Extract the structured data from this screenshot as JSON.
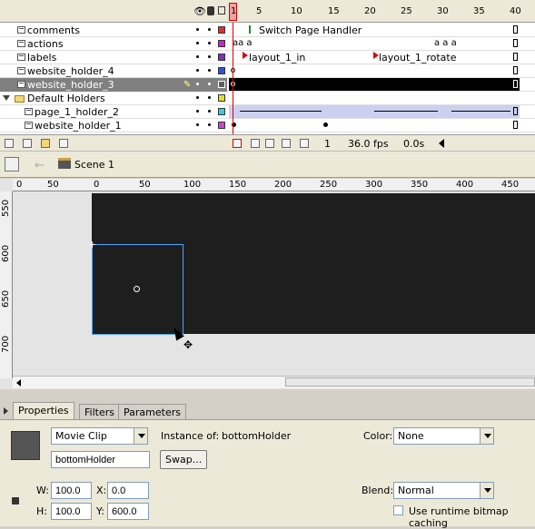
{
  "timeline": {
    "frame_numbers": [
      "1",
      "5",
      "10",
      "15",
      "20",
      "25",
      "30",
      "35",
      "40"
    ],
    "layers": [
      {
        "name": "comments",
        "color": "#e03030",
        "label": "Switch Page Handler"
      },
      {
        "name": "actions",
        "color": "#d020d0",
        "label": ""
      },
      {
        "name": "labels",
        "color": "#8030c0",
        "label": "layout_1_in",
        "label2": "layout_1_rotate"
      },
      {
        "name": "website_holder_4",
        "color": "#3050e0",
        "label": ""
      },
      {
        "name": "website_holder_3",
        "color": "#606060",
        "label": "",
        "selected": true
      },
      {
        "name": "Default Holders",
        "color": "#e0e030",
        "label": "",
        "folder": true
      },
      {
        "name": "page_1_holder_2",
        "color": "#30d0e0",
        "label": ""
      },
      {
        "name": "website_holder_1",
        "color": "#d040d0",
        "label": ""
      }
    ],
    "footer": {
      "current_frame": "1",
      "fps": "36.0 fps",
      "elapsed": "0.0s"
    }
  },
  "editbar": {
    "scene": "Scene 1"
  },
  "ruler": {
    "h": [
      "0",
      "50",
      "0",
      "50",
      "100",
      "150",
      "200",
      "250",
      "300",
      "350",
      "400",
      "450"
    ],
    "v": [
      "550",
      "600",
      "650",
      "700"
    ]
  },
  "properties": {
    "tabs": [
      "Properties",
      "Filters",
      "Parameters"
    ],
    "symbol_type": "Movie Clip",
    "instance_of_label": "Instance of:",
    "instance_of_value": "bottomHolder",
    "instance_name": "bottomHolder",
    "swap_label": "Swap...",
    "color_label": "Color:",
    "color_value": "None",
    "blend_label": "Blend:",
    "blend_value": "Normal",
    "bitmap_caching_label": "Use runtime bitmap caching",
    "w_label": "W:",
    "w_value": "100.0",
    "h_label": "H:",
    "h_value": "100.0",
    "x_label": "X:",
    "x_value": "0.0",
    "y_label": "Y:",
    "y_value": "600.0"
  }
}
